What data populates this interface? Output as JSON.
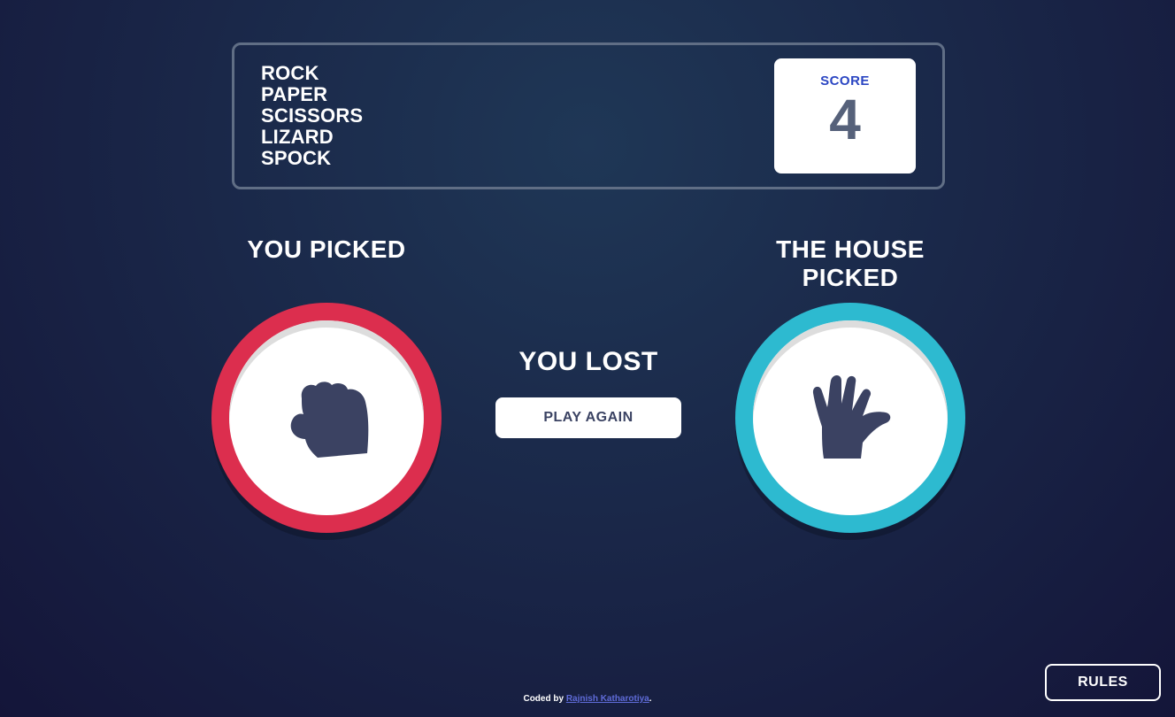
{
  "header": {
    "title_lines": [
      "ROCK",
      "PAPER",
      "SCISSORS",
      "LIZARD",
      "SPOCK"
    ],
    "score_label": "SCORE",
    "score_value": "4"
  },
  "game": {
    "you_picked_label": "YOU PICKED",
    "house_picked_label": "THE HOUSE PICKED",
    "you_choice_icon": "rock-icon",
    "house_choice_icon": "spock-icon",
    "result_text": "YOU LOST",
    "play_again_label": "PLAY AGAIN"
  },
  "colors": {
    "rock": "#dc2e4e",
    "spock": "#2dbad0",
    "score_label": "#2a45c2"
  },
  "rules_label": "RULES",
  "footer": {
    "prefix": "Coded by",
    "author": "Rajnish Katharotiya",
    "suffix": "."
  }
}
